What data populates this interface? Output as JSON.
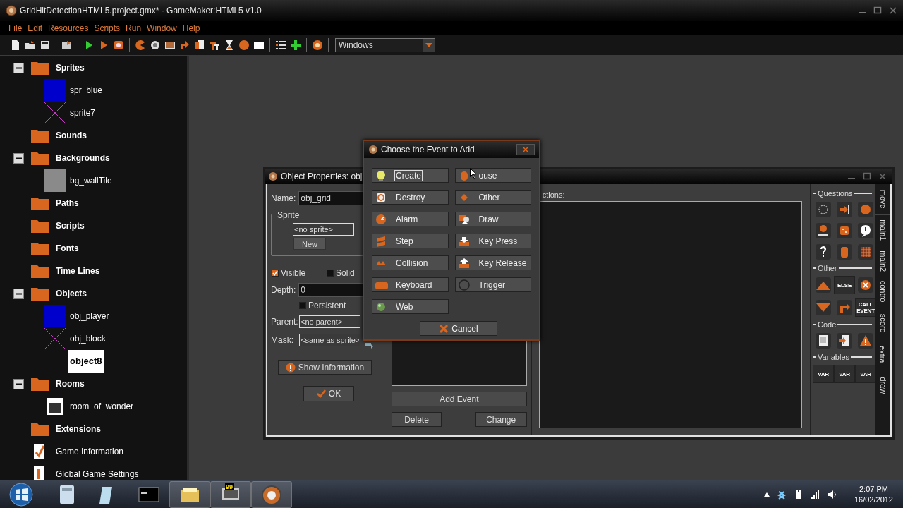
{
  "window": {
    "title": "GridHitDetectionHTML5.project.gmx* - GameMaker:HTML5 v1.0"
  },
  "menu": [
    "File",
    "Edit",
    "Resources",
    "Scripts",
    "Run",
    "Window",
    "Help"
  ],
  "toolbar": {
    "target": "Windows"
  },
  "tree": [
    {
      "label": "Sprites",
      "kind": "folder",
      "expanded": true,
      "children": [
        {
          "label": "spr_blue",
          "kind": "blue",
          "selected": false
        },
        {
          "label": "sprite7",
          "kind": "cross",
          "selected": false
        }
      ]
    },
    {
      "label": "Sounds",
      "kind": "folder"
    },
    {
      "label": "Backgrounds",
      "kind": "folder",
      "expanded": true,
      "children": [
        {
          "label": "bg_wallTile",
          "kind": "gray",
          "selected": false
        }
      ]
    },
    {
      "label": "Paths",
      "kind": "folder"
    },
    {
      "label": "Scripts",
      "kind": "folder"
    },
    {
      "label": "Fonts",
      "kind": "folder"
    },
    {
      "label": "Time Lines",
      "kind": "folder"
    },
    {
      "label": "Objects",
      "kind": "folder",
      "expanded": true,
      "children": [
        {
          "label": "obj_player",
          "kind": "blue",
          "selected": false
        },
        {
          "label": "obj_block",
          "kind": "cross",
          "selected": false
        },
        {
          "label": "object8",
          "kind": "none",
          "selected": true
        }
      ]
    },
    {
      "label": "Rooms",
      "kind": "folder",
      "expanded": true,
      "children": [
        {
          "label": "room_of_wonder",
          "kind": "room",
          "selected": false
        }
      ]
    },
    {
      "label": "Extensions",
      "kind": "folder"
    },
    {
      "label": "Game Information",
      "kind": "info"
    },
    {
      "label": "Global Game Settings",
      "kind": "settings"
    }
  ],
  "object_properties": {
    "title": "Object Properties: obj",
    "name_label": "Name:",
    "name": "obj_grid",
    "sprite_group": "Sprite",
    "sprite": "<no sprite>",
    "new_button": "New",
    "visible": {
      "label": "Visible",
      "checked": true
    },
    "solid": {
      "label": "Solid",
      "checked": false
    },
    "depth_label": "Depth:",
    "depth": "0",
    "persistent": {
      "label": "Persistent",
      "checked": false
    },
    "parent_label": "Parent:",
    "parent": "<no parent>",
    "mask_label": "Mask:",
    "mask": "<same as sprite>",
    "show_info": "Show Information",
    "ok": "OK",
    "actions_label": "ctions:",
    "add_event": "Add Event",
    "delete": "Delete",
    "change": "Change",
    "palette": [
      {
        "section": "Questions",
        "icons": [
          {
            "kind": "ring"
          },
          {
            "kind": "arrow"
          },
          {
            "kind": "ball"
          },
          {
            "kind": "count"
          },
          {
            "kind": "dice"
          },
          {
            "kind": "question-bubble"
          },
          {
            "kind": "question"
          },
          {
            "kind": "jar"
          },
          {
            "kind": "grid"
          }
        ]
      },
      {
        "section": "Other",
        "icons": [
          {
            "kind": "up"
          },
          {
            "kind": "text",
            "text": "ELSE"
          },
          {
            "kind": "close"
          },
          {
            "kind": "down"
          },
          {
            "kind": "return"
          },
          {
            "kind": "text",
            "text": "CALL EVENT"
          }
        ]
      },
      {
        "section": "Code",
        "icons": [
          {
            "kind": "doc"
          },
          {
            "kind": "doc-arrow"
          },
          {
            "kind": "warning"
          }
        ]
      },
      {
        "section": "Variables",
        "icons": [
          {
            "kind": "text",
            "text": "VAR"
          },
          {
            "kind": "text",
            "text": "VAR"
          },
          {
            "kind": "text",
            "text": "VAR"
          }
        ]
      }
    ],
    "tabs": [
      "move",
      "main1",
      "main2",
      "control",
      "score",
      "extra",
      "draw"
    ]
  },
  "event_dialog": {
    "title": "Choose the Event to Add",
    "events": [
      {
        "label": "Create",
        "kind": "bulb",
        "focused": true
      },
      {
        "label": "ouse",
        "kind": "mouse",
        "focused": false
      },
      {
        "label": "Destroy",
        "kind": "destroy",
        "focused": false
      },
      {
        "label": "Other",
        "kind": "other",
        "focused": false
      },
      {
        "label": "Alarm",
        "kind": "alarm",
        "focused": false
      },
      {
        "label": "Draw",
        "kind": "draw",
        "focused": false
      },
      {
        "label": "Step",
        "kind": "step",
        "focused": false
      },
      {
        "label": "Key Press",
        "kind": "keydown",
        "focused": false
      },
      {
        "label": "Collision",
        "kind": "collision",
        "focused": false
      },
      {
        "label": "Key Release",
        "kind": "keyup",
        "focused": false
      },
      {
        "label": "Keyboard",
        "kind": "keyboard",
        "focused": false
      },
      {
        "label": "Trigger",
        "kind": "trigger",
        "focused": false
      },
      {
        "label": "Web",
        "kind": "web",
        "focused": false
      }
    ],
    "cancel": "Cancel"
  },
  "taskbar": {
    "time": "2:07 PM",
    "date": "16/02/2012",
    "badge": "99"
  }
}
